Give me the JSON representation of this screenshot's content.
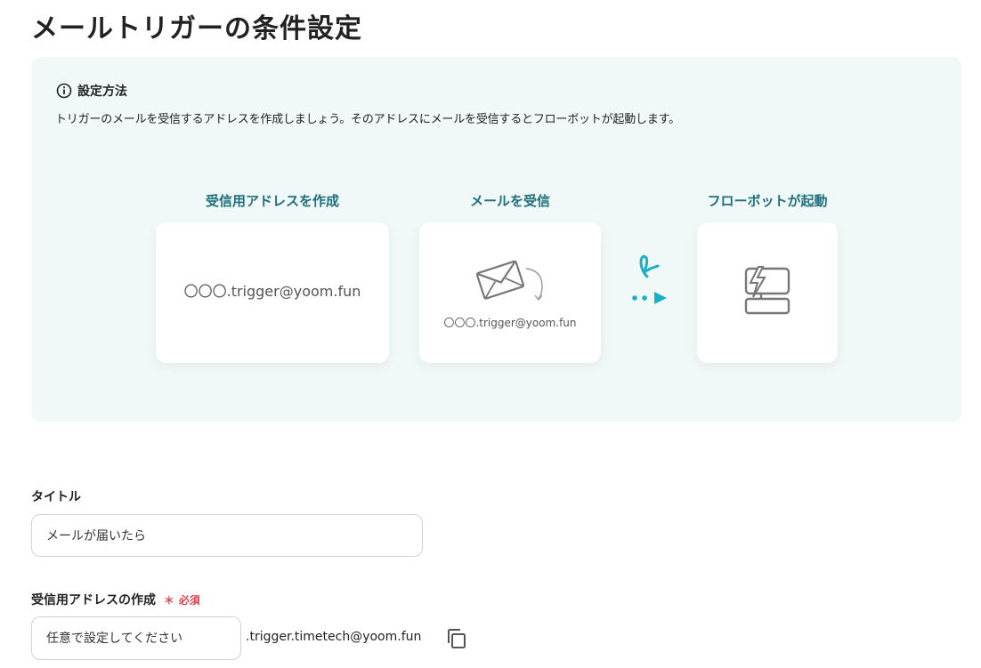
{
  "page": {
    "title": "メールトリガーの条件設定"
  },
  "guide": {
    "heading": "設定方法",
    "description": "トリガーのメールを受信するアドレスを作成しましょう。そのアドレスにメールを受信するとフローボットが起動します。",
    "steps": [
      {
        "label": "受信用アドレスを作成",
        "card_text": "〇〇〇.trigger@yoom.fun"
      },
      {
        "label": "メールを受信",
        "card_text": "〇〇〇.trigger@yoom.fun",
        "icon": "envelope-icon"
      },
      {
        "label": "フローボットが起動",
        "icon": "flowbot-icon"
      }
    ],
    "accent_color": "#1f6f7c",
    "arrow_color": "#1ab0c8"
  },
  "form": {
    "title_field": {
      "label": "タイトル",
      "value": "メールが届いたら"
    },
    "address_field": {
      "label": "受信用アドレスの作成",
      "required_mark": "＊",
      "required_text": "必須",
      "placeholder": "任意で設定してください",
      "suffix": ".trigger.timetech@yoom.fun"
    }
  }
}
